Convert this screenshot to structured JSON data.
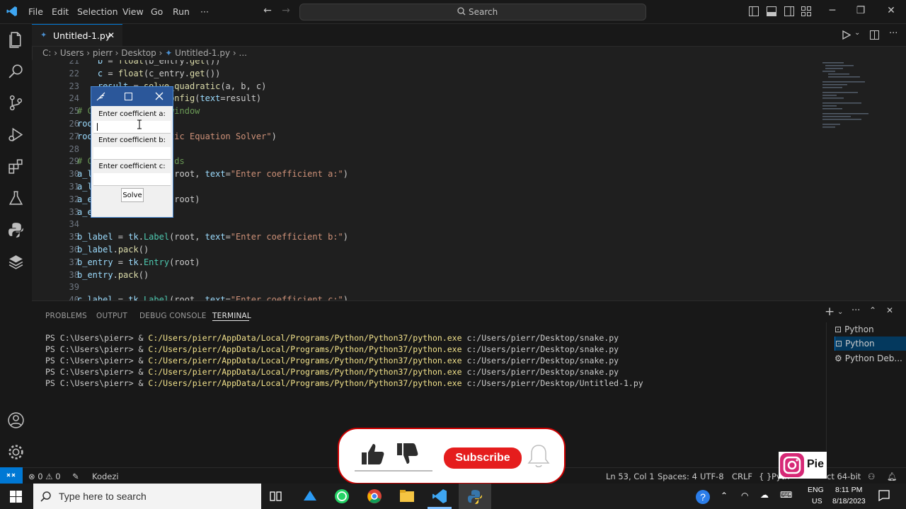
{
  "menu": {
    "file": "File",
    "edit": "Edit",
    "selection": "Selection",
    "view": "View",
    "go": "Go",
    "run": "Run",
    "more": "···"
  },
  "search": {
    "label": "Search"
  },
  "tab": {
    "name": "Untitled-1.py",
    "close": "✕"
  },
  "breadcrumb": {
    "path": "C: › Users › pierr › Desktop ›",
    "file": "Untitled-1.py",
    "more": "› ..."
  },
  "editor": {
    "lines": [
      {
        "n": "21",
        "code": "    b = float(b_entry.get())"
      },
      {
        "n": "22",
        "code": "    c = float(c_entry.get())"
      },
      {
        "n": "23",
        "code": "    result = solve_quadratic(a, b, c)"
      },
      {
        "n": "24",
        "code": "    result_label.config(text=result)"
      },
      {
        "n": "25",
        "code": "# Create the main window"
      },
      {
        "n": "26",
        "code": "root = tk.Tk()"
      },
      {
        "n": "27",
        "code": "root.title(\"Quadratic Equation Solver\")"
      },
      {
        "n": "28",
        "code": ""
      },
      {
        "n": "29",
        "code": "# Create input fields"
      },
      {
        "n": "30",
        "code": "a_label = tk.Label(root, text=\"Enter coefficient a:\")"
      },
      {
        "n": "31",
        "code": "a_label.pack()"
      },
      {
        "n": "32",
        "code": "a_entry = tk.Entry(root)"
      },
      {
        "n": "33",
        "code": "a_entry.pack()"
      },
      {
        "n": "34",
        "code": ""
      },
      {
        "n": "35",
        "code": "b_label = tk.Label(root, text=\"Enter coefficient b:\")"
      },
      {
        "n": "36",
        "code": "b_label.pack()"
      },
      {
        "n": "37",
        "code": "b_entry = tk.Entry(root)"
      },
      {
        "n": "38",
        "code": "b_entry.pack()"
      },
      {
        "n": "39",
        "code": ""
      },
      {
        "n": "40",
        "code": "c_label = tk.Label(root, text=\"Enter coefficient c:\")"
      }
    ]
  },
  "tkwindow": {
    "label_a": "Enter coefficient a:",
    "label_b": "Enter coefficient b:",
    "label_c": "Enter coefficient c:",
    "solve": "Solve"
  },
  "panel": {
    "tabs": {
      "problems": "PROBLEMS",
      "output": "OUTPUT",
      "debug": "DEBUG CONSOLE",
      "terminal": "TERMINAL"
    },
    "terminal_lines": [
      {
        "prompt": "PS C:\\Users\\pierr> & ",
        "exe": "C:/Users/pierr/AppData/Local/Programs/Python/Python37/python.exe",
        "arg": " c:/Users/pierr/Desktop/snake.py"
      },
      {
        "prompt": "PS C:\\Users\\pierr> & ",
        "exe": "C:/Users/pierr/AppData/Local/Programs/Python/Python37/python.exe",
        "arg": " c:/Users/pierr/Desktop/snake.py"
      },
      {
        "prompt": "PS C:\\Users\\pierr> & ",
        "exe": "C:/Users/pierr/AppData/Local/Programs/Python/Python37/python.exe",
        "arg": " c:/Users/pierr/Desktop/snake.py"
      },
      {
        "prompt": "PS C:\\Users\\pierr> & ",
        "exe": "C:/Users/pierr/AppData/Local/Programs/Python/Python37/python.exe",
        "arg": " c:/Users/pierr/Desktop/snake.py"
      },
      {
        "prompt": "PS C:\\Users\\pierr> & ",
        "exe": "C:/Users/pierr/AppData/Local/Programs/Python/Python37/python.exe",
        "arg": " c:/Users/pierr/Desktop/Untitled-1.py"
      }
    ],
    "terminals": [
      "Python",
      "Python",
      "Python Deb..."
    ]
  },
  "statusbar": {
    "errors": "0",
    "warnings": "0",
    "kodezi": "Kodezi",
    "position": "Ln 53, Col 1",
    "spaces": "Spaces: 4",
    "encoding": "UTF-8",
    "eol": "CRLF",
    "language": "Pyth",
    "interpreter": "ct 64-bit"
  },
  "overlay": {
    "subscribe": "Subscribe",
    "insta_text": "Pie"
  },
  "taskbar": {
    "search_placeholder": "Type here to search",
    "lang": "ENG",
    "region": "US",
    "time": "8:11 PM",
    "date": "8/18/2023"
  },
  "colors": {
    "accent": "#0078d4",
    "subscribe_red": "#e51d1d",
    "tk_titlebar": "#2b579a"
  }
}
